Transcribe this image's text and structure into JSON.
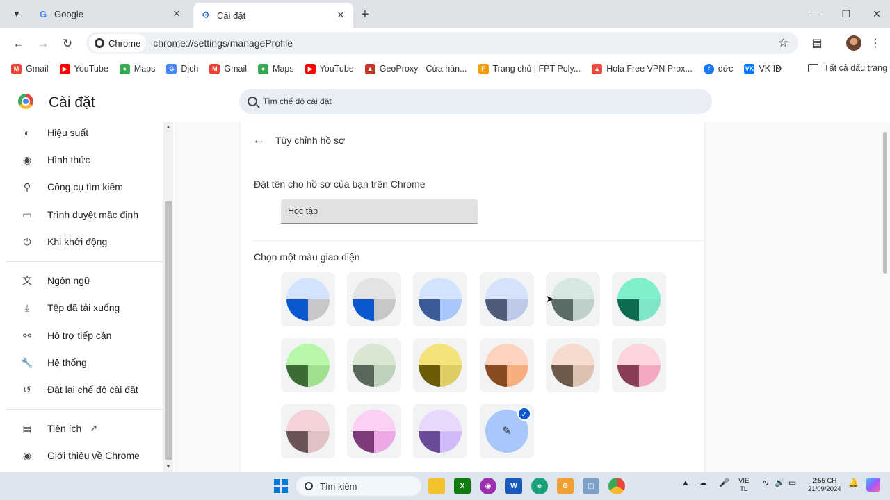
{
  "tabs": [
    {
      "label": "Google",
      "icon": "google-icon"
    },
    {
      "label": "Cài đặt",
      "icon": "settings-gear-icon"
    }
  ],
  "toolbar": {
    "chip_label": "Chrome",
    "url": "chrome://settings/manageProfile"
  },
  "bookmarks": [
    {
      "label": "Gmail",
      "icon": "gmail-icon",
      "color": "#ea4335"
    },
    {
      "label": "YouTube",
      "icon": "youtube-icon",
      "color": "#ff0000"
    },
    {
      "label": "Maps",
      "icon": "maps-icon",
      "color": "#34a853"
    },
    {
      "label": "Dịch",
      "icon": "translate-icon",
      "color": "#4285f4"
    },
    {
      "label": "Gmail",
      "icon": "gmail-icon",
      "color": "#ea4335"
    },
    {
      "label": "Maps",
      "icon": "maps-icon",
      "color": "#34a853"
    },
    {
      "label": "YouTube",
      "icon": "youtube-icon",
      "color": "#ff0000"
    },
    {
      "label": "GeoProxy - Cửa hàn...",
      "icon": "geoproxy-icon",
      "color": "#c0392b"
    },
    {
      "label": "Trang chủ | FPT Poly...",
      "icon": "fpt-icon",
      "color": "#f39c12"
    },
    {
      "label": "Hola Free VPN Prox...",
      "icon": "hola-icon",
      "color": "#e74c3c"
    },
    {
      "label": "dức",
      "icon": "facebook-icon",
      "color": "#1877f2"
    },
    {
      "label": "VK ID",
      "icon": "vk-icon",
      "color": "#0077ff"
    }
  ],
  "bookmarks_more": "»",
  "bookmarks_folder": "Tất cả dấu trang",
  "settings": {
    "title": "Cài đặt",
    "search_placeholder": "Tìm chế độ cài đặt"
  },
  "sidebar": {
    "items": [
      {
        "label": "Hiệu suất",
        "icon": "performance-icon"
      },
      {
        "label": "Hình thức",
        "icon": "palette-icon"
      },
      {
        "label": "Công cụ tìm kiếm",
        "icon": "search-icon"
      },
      {
        "label": "Trình duyệt mặc định",
        "icon": "browser-icon"
      },
      {
        "label": "Khi khởi động",
        "icon": "power-icon"
      },
      {
        "label": "Ngôn ngữ",
        "icon": "language-icon"
      },
      {
        "label": "Tệp đã tải xuống",
        "icon": "download-icon"
      },
      {
        "label": "Hỗ trợ tiếp cận",
        "icon": "accessibility-icon"
      },
      {
        "label": "Hệ thống",
        "icon": "wrench-icon"
      },
      {
        "label": "Đặt lại chế độ cài đặt",
        "icon": "reset-icon"
      },
      {
        "label": "Tiện ích",
        "icon": "extension-icon"
      },
      {
        "label": "Giới thiệu về Chrome",
        "icon": "chrome-icon"
      }
    ]
  },
  "card": {
    "title": "Tùy chỉnh hồ sơ",
    "name_label": "Đặt tên cho hồ sơ của bạn trên Chrome",
    "name_value": "Học tập",
    "color_label": "Chọn một màu giao diện"
  },
  "themes": [
    {
      "top": "#d3e3fd",
      "bl": "#0b57d0",
      "br": "#c7c7c7"
    },
    {
      "top": "#e3e3e3",
      "bl": "#0b57d0",
      "br": "#c7c7c7"
    },
    {
      "top": "#d3e3fd",
      "bl": "#3a5a9a",
      "br": "#a8c7fa"
    },
    {
      "top": "#d6e2fb",
      "bl": "#4f5b78",
      "br": "#bccae8"
    },
    {
      "top": "#d6e8e3",
      "bl": "#5b6b67",
      "br": "#bfd0cb"
    },
    {
      "top": "#7ff0cb",
      "bl": "#0f6b50",
      "br": "#7ee6c6"
    },
    {
      "top": "#b6f7a9",
      "bl": "#3c6b35",
      "br": "#a1e08f"
    },
    {
      "top": "#d9e7d2",
      "bl": "#58685a",
      "br": "#bfd2bb"
    },
    {
      "top": "#f5e27a",
      "bl": "#6b5c0a",
      "br": "#e0cc65"
    },
    {
      "top": "#fdd3bd",
      "bl": "#8a4a22",
      "br": "#f8ad7f"
    },
    {
      "top": "#f6dccf",
      "bl": "#6e5a4d",
      "br": "#dcc2b3"
    },
    {
      "top": "#fdd4de",
      "bl": "#8a3b56",
      "br": "#f5a9c0"
    },
    {
      "top": "#f4d3d8",
      "bl": "#6b5458",
      "br": "#e0c2c5"
    },
    {
      "top": "#fbd0f3",
      "bl": "#7d3b7c",
      "br": "#eda8e6"
    },
    {
      "top": "#e8d9fc",
      "bl": "#6a4b9a",
      "br": "#d1b8f7"
    }
  ],
  "taskbar": {
    "search_label": "Tìm kiếm",
    "lang_line1": "VIE",
    "lang_line2": "TL",
    "time": "2:55 CH",
    "date": "21/09/2024"
  }
}
